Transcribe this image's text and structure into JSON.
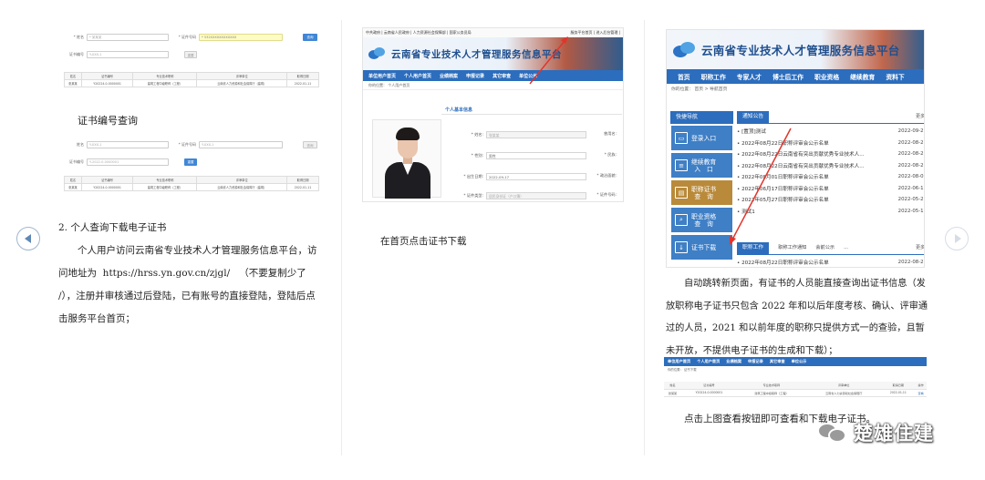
{
  "panel1": {
    "form_top": {
      "row1": [
        {
          "label": "* 姓名",
          "value": "* 某某某"
        },
        {
          "label": "* 证件号码",
          "value": "* 532XXXXXXXXXXXX"
        }
      ],
      "query_btn": "查询",
      "row2": [
        {
          "label": "证书编号",
          "value": "Y-XXX-1"
        }
      ],
      "reset_btn": "重置"
    },
    "table_top": {
      "headers": [
        "姓名",
        "证书编号",
        "专业技术职称",
        "评审单位",
        "取得日期"
      ],
      "row": [
        "张某某",
        "Y20224-0-0000001",
        "建筑工程中级职称（工程）",
        "云南省人力资源和社会保障厅（建筑）",
        "2022-01-11"
      ]
    },
    "section_caption": "证书编号查询",
    "form_bottom": {
      "row1": [
        {
          "label": "姓名",
          "value": "Y-XXX-1"
        },
        {
          "label": "* 证件号码",
          "value": "Y-XXX-1"
        }
      ],
      "query_btn": "查询",
      "row2": [
        {
          "label": "证书编号",
          "value": "Y-2022-0-0000001"
        }
      ],
      "reset_btn": "重置"
    },
    "table_bottom": {
      "headers": [
        "姓名",
        "证书编号",
        "专业技术职称",
        "评审单位",
        "取得日期"
      ],
      "row": [
        "张某某",
        "Y20224-0-0000001",
        "建筑工程中级职称（工程）",
        "云南省人力资源和社会保障厅（建筑）",
        "2022-01-11"
      ]
    },
    "heading": "2. 个人查询下载电子证书",
    "para_lines": [
      "个人用户访问云南省专业技术人才管理服务信息平台，访",
      "问地址为  https://hrss.yn.gov.cn/zjgl/   （不要复制少了",
      "/），注册并审核通过后登陆，已有账号的直接登陆，登陆后点",
      "击服务平台首页；"
    ]
  },
  "panel2": {
    "topbar_left": "中共政府 | 云南省人民政府 | 人力资源社会保障部 | 国家公务员局",
    "topbar_right": "服务平台首页 | 进入后台管理 |",
    "site_title": "云南省专业技术人才管理服务信息平台",
    "nav": [
      "单位用户首页",
      "个人用户首页",
      "业绩档案",
      "申报记录",
      "其它审查",
      "单位公示"
    ],
    "breadcrumb": "你的位置： 个人用户首页",
    "section_title": "个人基本信息",
    "fields": [
      {
        "label": "* 姓名:",
        "value": "张某某"
      },
      {
        "label": "* 性别:",
        "value": "男性"
      },
      {
        "label": "* 出生日期:",
        "value": "2022-09-17"
      },
      {
        "label": "* 证件类型:",
        "value": "居民身份证（户口簿）"
      }
    ],
    "right_labels": [
      "曾用名:",
      "* 民族:",
      "* 政治面貌:",
      "* 证件号码:"
    ],
    "caption": "在首页点击证书下载"
  },
  "panel3": {
    "site_title": "云南省专业技术人才管理服务信息平台",
    "nav": [
      "首页",
      "职称工作",
      "专家人才",
      "博士后工作",
      "职业资格",
      "继续教育",
      "资料下"
    ],
    "breadcrumb": "你的位置： 首页 > 导航首页",
    "quick_title": "快捷导航",
    "quick_buttons": [
      {
        "label": "登录入口",
        "icon": "monitor-icon"
      },
      {
        "label": "继续教育\n入　口",
        "icon": "document-icon"
      },
      {
        "label": "职称证书\n查　询",
        "icon": "certificate-icon"
      },
      {
        "label": "职业资格\n查　询",
        "icon": "search-doc-icon"
      },
      {
        "label": "证书下载",
        "icon": "download-icon"
      }
    ],
    "notice_tab": "通知公告",
    "more": "更多",
    "notices": [
      {
        "title": "• [置顶]测试",
        "date": "2022-09-23"
      },
      {
        "title": "• 2022年08月22日职称评审会公示名单",
        "date": "2022-08-22"
      },
      {
        "title": "• 2022年08月22日云南省有突出贡献优秀专业技术人...",
        "date": "2022-08-22"
      },
      {
        "title": "• 2022年08月22日云南省有突出贡献优秀专业技术人...",
        "date": "2022-08-22"
      },
      {
        "title": "• 2022年08月01日职称评审会公示名单",
        "date": "2022-08-01"
      },
      {
        "title": "• 2022年06月17日职称评审会公示名单",
        "date": "2022-06-17"
      },
      {
        "title": "• 2022年05月27日职称评审会公示名单",
        "date": "2022-05-27"
      },
      {
        "title": "• 测试1",
        "date": "2022-05-16"
      }
    ],
    "work_tabs": [
      "职称工作",
      "职称工作通知",
      "会前公示",
      "..."
    ],
    "work_more": "更多",
    "work_item": "• 2022年08月22日职称评审会公示名单",
    "work_date": "2022-08-22",
    "para_lines": [
      "自动跳转新页面，有证书的人员能直接查询出证书信息（发",
      "放职称电子证书只包含 2022 年和以后年度考核、确认、评审通",
      "过的人员，2021 和以前年度的职称只提供方式一的查验，且暂",
      "未开放，不提供电子证书的生成和下载）；"
    ],
    "nav4": [
      "单位用户首页",
      "个人用户首页",
      "业绩档案",
      "申报记录",
      "其它审查",
      "单位公示"
    ],
    "breadcrumb4": "你的位置： 证书下载",
    "table4_headers": [
      "姓名",
      "证书编号",
      "专业技术职称",
      "评审单位",
      "取得日期",
      "操作"
    ],
    "table4_row": [
      "张某某",
      "Y20224-0-0000001",
      "建筑工程中级职称（工程）",
      "云南省人力资源和社会保障厅",
      "2022-01-11",
      "查看"
    ],
    "caption": "点击上图查看按钮即可查看和下载电子证书。"
  },
  "watermark": "楚雄住建"
}
